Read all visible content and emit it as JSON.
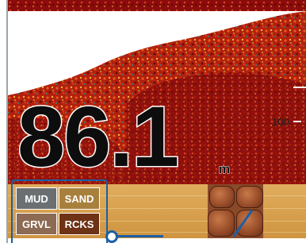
{
  "depth": {
    "value": "86.1",
    "unit": "m"
  },
  "scale": {
    "label": "100"
  },
  "bottom_legend": {
    "items": [
      {
        "label": "MUD",
        "color": "#6b6f72"
      },
      {
        "label": "SAND",
        "color": "#a8803e"
      },
      {
        "label": "GRVL",
        "color": "#8c6a53"
      },
      {
        "label": "RCKS",
        "color": "#6e3216"
      }
    ]
  },
  "colors": {
    "callout": "#1b5fa6",
    "echo_strong": "#7a0a0a",
    "echo_mid": "#d23a18",
    "echo_weak": "#e7c24a",
    "seabed": "#d9a24f"
  }
}
